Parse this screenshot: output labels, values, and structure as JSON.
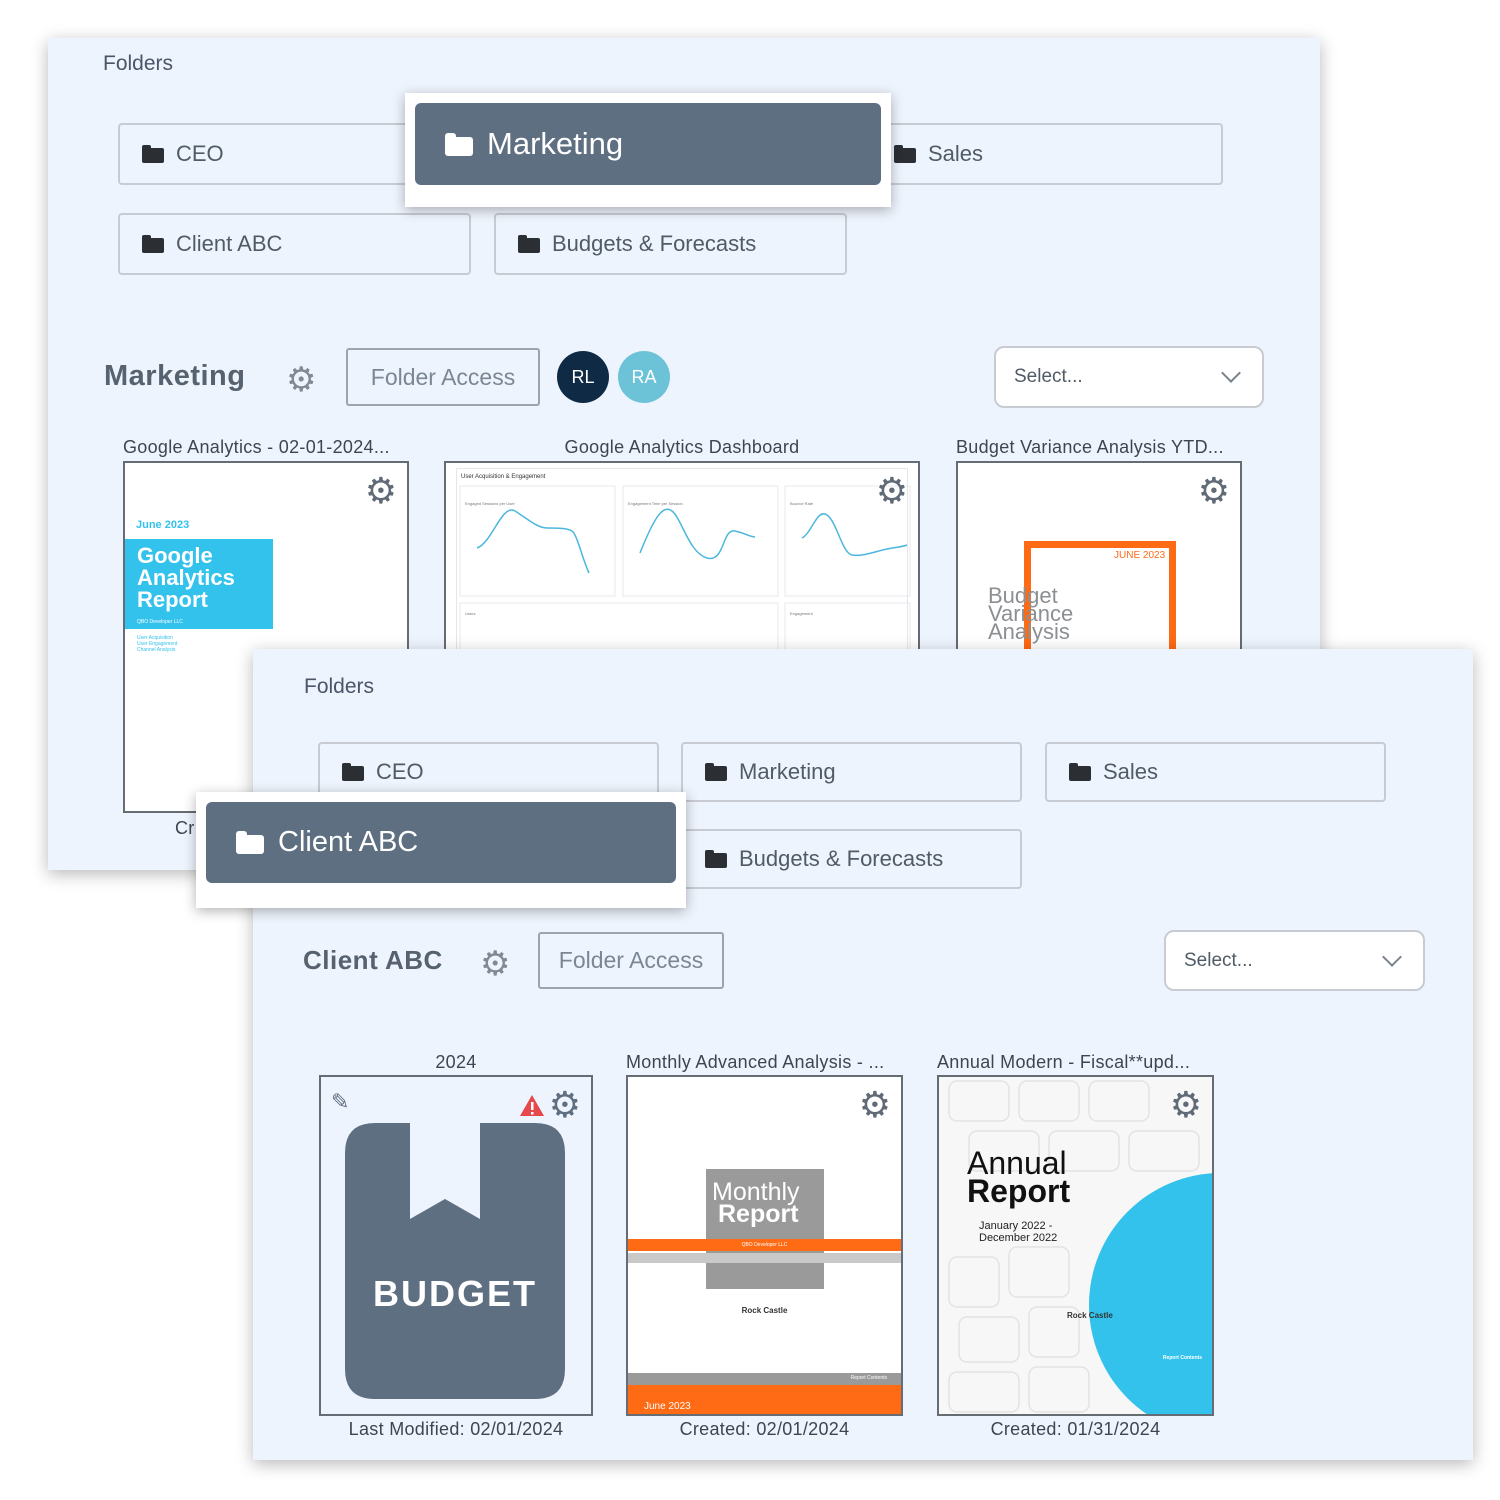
{
  "back_panel": {
    "folders_heading": "Folders",
    "folders": [
      {
        "label": "CEO"
      },
      {
        "label": "Sales"
      },
      {
        "label": "Client ABC"
      },
      {
        "label": "Budgets & Forecasts"
      }
    ],
    "active_folder": "Marketing",
    "folder_title": "Marketing",
    "folder_access_label": "Folder Access",
    "avatars": [
      {
        "initials": "RL",
        "color": "#0f2a44"
      },
      {
        "initials": "RA",
        "color": "#6cc3d8"
      }
    ],
    "select_placeholder": "Select...",
    "reports": [
      {
        "title": "Google Analytics - 02-01-2024...",
        "footer": "Cr"
      },
      {
        "title": "Google Analytics Dashboard"
      },
      {
        "title": "Budget Variance Analysis YTD..."
      }
    ],
    "thumbs": {
      "ga_report": {
        "date": "June 2023",
        "line1": "Google",
        "line2": "Analytics",
        "line3": "Report",
        "company": "QBO Developer LLC",
        "items": [
          "User Acquisition",
          "User Engagement",
          "Channel Analysis"
        ]
      },
      "dashboard": {
        "header": "User Acquisition & Engagement",
        "charts": [
          "Engaged Sessions per User",
          "Engagement Time per Session",
          "Bounce Rate"
        ],
        "bottom": [
          "Users",
          "Engagement"
        ]
      },
      "budget_var": {
        "date": "JUNE 2023",
        "line1": "Budget",
        "line2": "Variance",
        "line3": "Analysis"
      }
    }
  },
  "front_panel": {
    "folders_heading": "Folders",
    "folders": [
      {
        "label": "CEO"
      },
      {
        "label": "Marketing"
      },
      {
        "label": "Sales"
      },
      {
        "label": "Budgets & Forecasts"
      }
    ],
    "active_folder": "Client ABC",
    "folder_title": "Client ABC",
    "folder_access_label": "Folder Access",
    "select_placeholder": "Select...",
    "reports": [
      {
        "title": "2024",
        "footer": "Last Modified: 02/01/2024"
      },
      {
        "title": "Monthly Advanced Analysis - ...",
        "footer": "Created: 02/01/2024"
      },
      {
        "title": "Annual Modern - Fiscal**upd...",
        "footer": "Created: 01/31/2024"
      }
    ],
    "thumbs": {
      "budget": {
        "label": "BUDGET"
      },
      "monthly": {
        "line1": "Monthly",
        "line2": "Report",
        "company": "QBO Developer LLC",
        "brand": "Rock Castle",
        "contents": "Report Contents",
        "date": "June 2023"
      },
      "annual": {
        "line1": "Annual",
        "line2": "Report",
        "period": "January 2022 -",
        "period2": "December 2022",
        "brand": "Rock Castle",
        "contents": "Report Contents"
      }
    }
  },
  "colors": {
    "panel_bg": "#eef4fd",
    "active_folder_bg": "#5f6f82",
    "accent_blue": "#33c2ec",
    "accent_orange": "#ff6a14",
    "warning_red": "#e5484d"
  }
}
